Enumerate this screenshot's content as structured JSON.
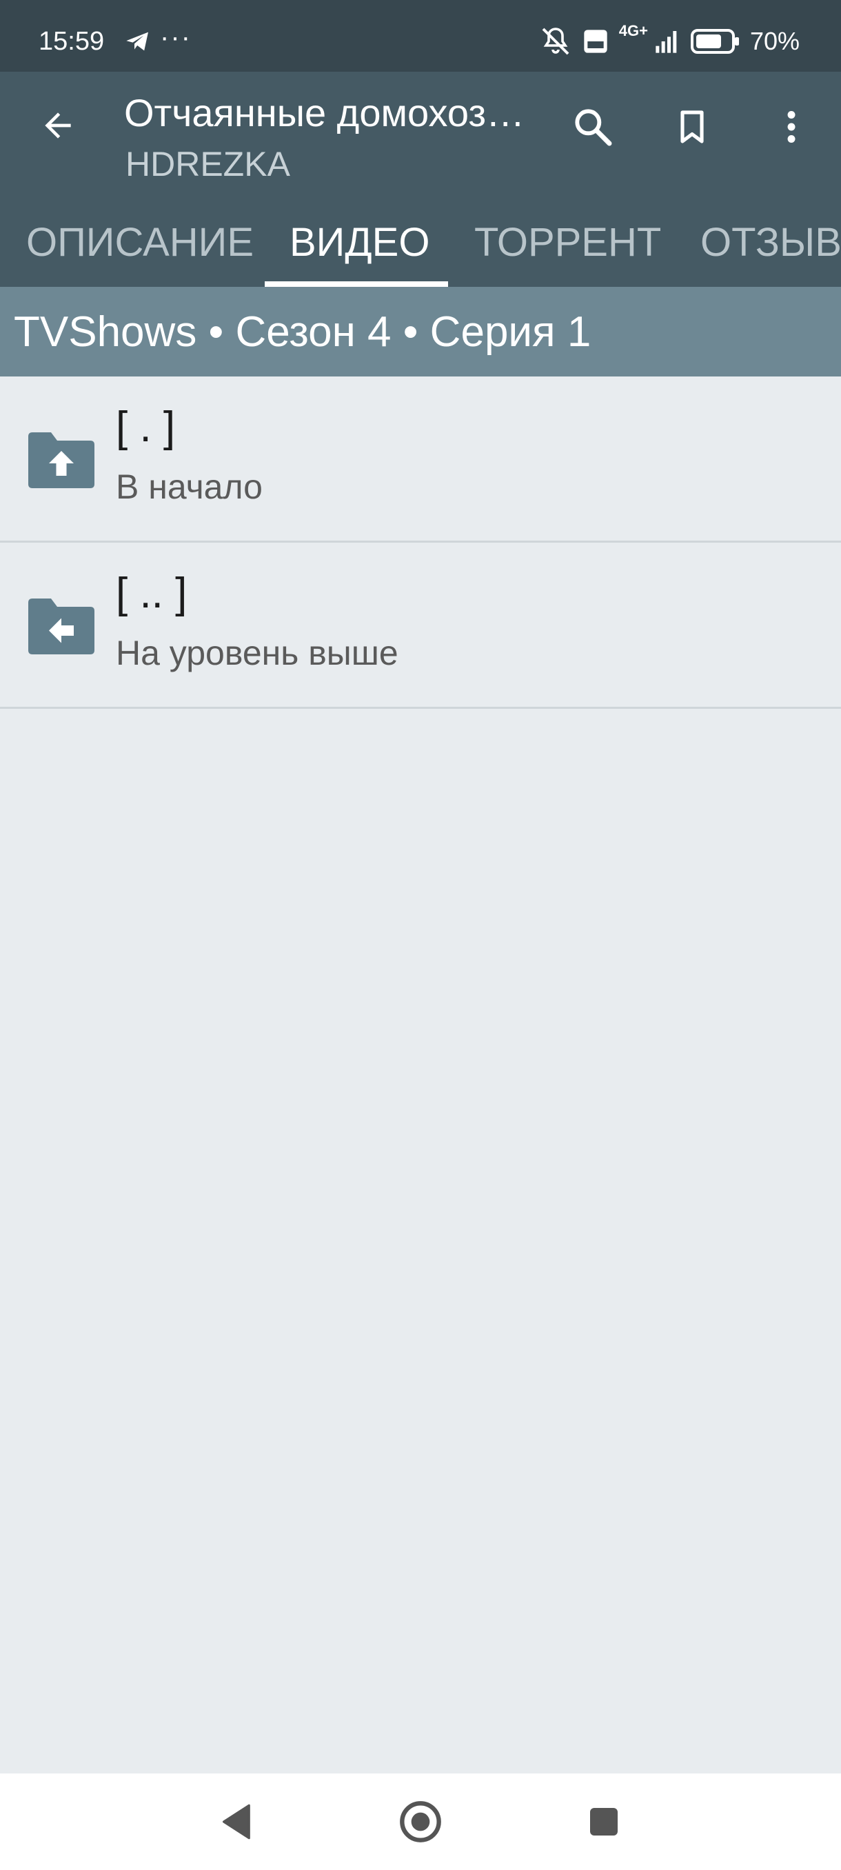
{
  "status_bar": {
    "time": "15:59",
    "more": "···",
    "icons": [
      "telegram-icon",
      "mute-icon",
      "volte-icon",
      "signal-4g-icon",
      "battery-icon"
    ],
    "network": "4G+",
    "battery": "70%"
  },
  "app_bar": {
    "title": "Отчаянные домохозя…",
    "subtitle": "HDREZKA",
    "actions": [
      "search-icon",
      "bookmark-icon",
      "more-vert-icon"
    ]
  },
  "tabs": [
    {
      "label": "ОПИСАНИЕ",
      "active": false
    },
    {
      "label": "ВИДЕО",
      "active": true
    },
    {
      "label": "ТОРРЕНТ",
      "active": false
    },
    {
      "label": "ОТЗЫВЫ",
      "active": false
    }
  ],
  "breadcrumb": "TVShows • Сезон 4 • Серия 1",
  "items": [
    {
      "name": "[ . ]",
      "description": "В начало",
      "icon": "folder-up-icon"
    },
    {
      "name": "[ .. ]",
      "description": "На уровень выше",
      "icon": "folder-back-icon"
    }
  ],
  "colors": {
    "status_bar": "#37474f",
    "app_bar": "#455a64",
    "breadcrumb_bar": "#6e8894",
    "background": "#e8ecef",
    "folder_icon": "#607d8b"
  }
}
